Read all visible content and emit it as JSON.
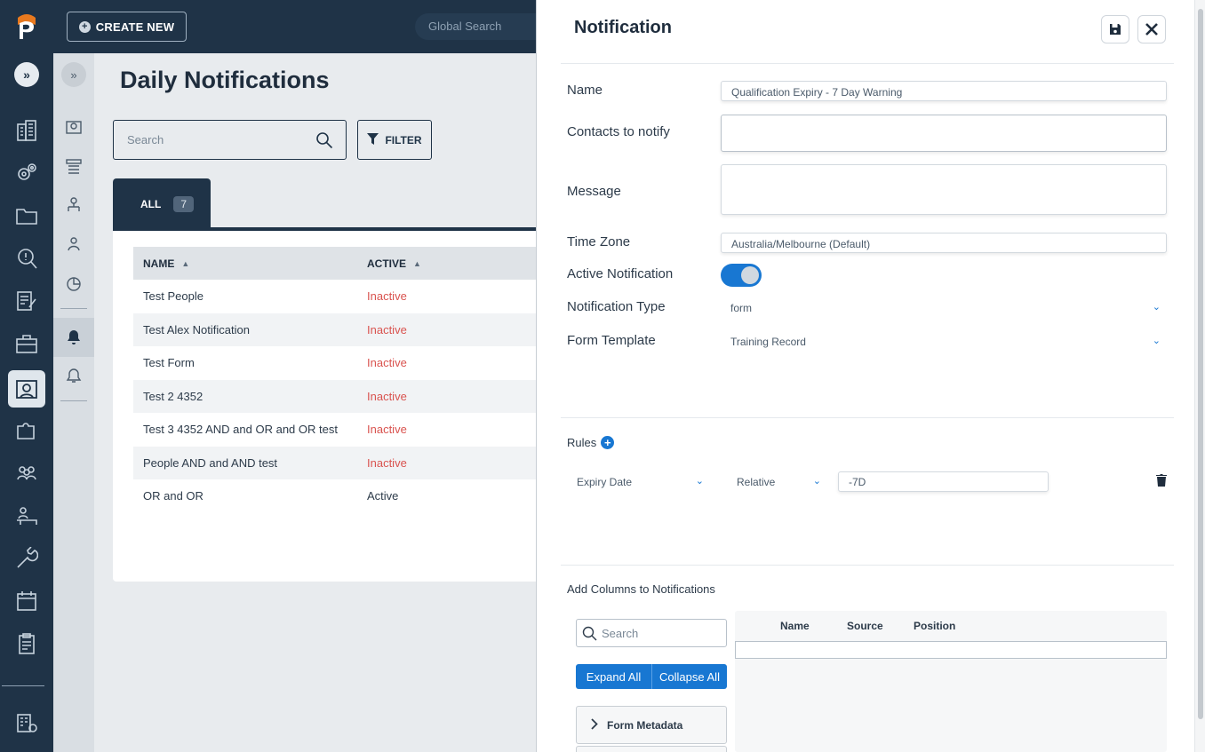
{
  "topbar": {
    "create_new": "CREATE NEW",
    "global_search_placeholder": "Global Search"
  },
  "page": {
    "title": "Daily Notifications",
    "search_placeholder": "Search",
    "filter_label": "FILTER",
    "tab_all_label": "ALL",
    "tab_all_count": "7"
  },
  "table": {
    "columns": [
      "NAME",
      "ACTIVE"
    ],
    "rows": [
      {
        "name": "Test People",
        "active": "Inactive"
      },
      {
        "name": "Test Alex Notification",
        "active": "Inactive"
      },
      {
        "name": "Test Form",
        "active": "Inactive"
      },
      {
        "name": "Test 2 4352",
        "active": "Inactive"
      },
      {
        "name": "Test 3 4352 AND and OR and OR test",
        "active": "Inactive"
      },
      {
        "name": "People AND and AND test",
        "active": "Inactive"
      },
      {
        "name": "OR and OR",
        "active": "Active"
      }
    ]
  },
  "panel": {
    "title": "Notification",
    "name_label": "Name",
    "name_value": "Qualification Expiry - 7 Day Warning",
    "contacts_label": "Contacts to notify",
    "contacts_value": "",
    "message_label": "Message",
    "message_value": "",
    "timezone_label": "Time Zone",
    "timezone_value": "Australia/Melbourne (Default)",
    "active_label": "Active Notification",
    "active_on": true,
    "type_label": "Notification Type",
    "type_value": "form",
    "template_label": "Form Template",
    "template_value": "Training Record",
    "rules_label": "Rules",
    "rule": {
      "field": "Expiry Date",
      "mode": "Relative",
      "value": "-7D"
    },
    "add_columns_label": "Add Columns to Notifications",
    "col_search_placeholder": "Search",
    "expand_all": "Expand All",
    "collapse_all": "Collapse All",
    "tree_item": "Form Metadata",
    "columns_headers": [
      "Name",
      "Source",
      "Position"
    ]
  },
  "colors": {
    "navy": "#1f3347",
    "accent_blue": "#1877d2",
    "inactive_red": "#d9534f"
  }
}
